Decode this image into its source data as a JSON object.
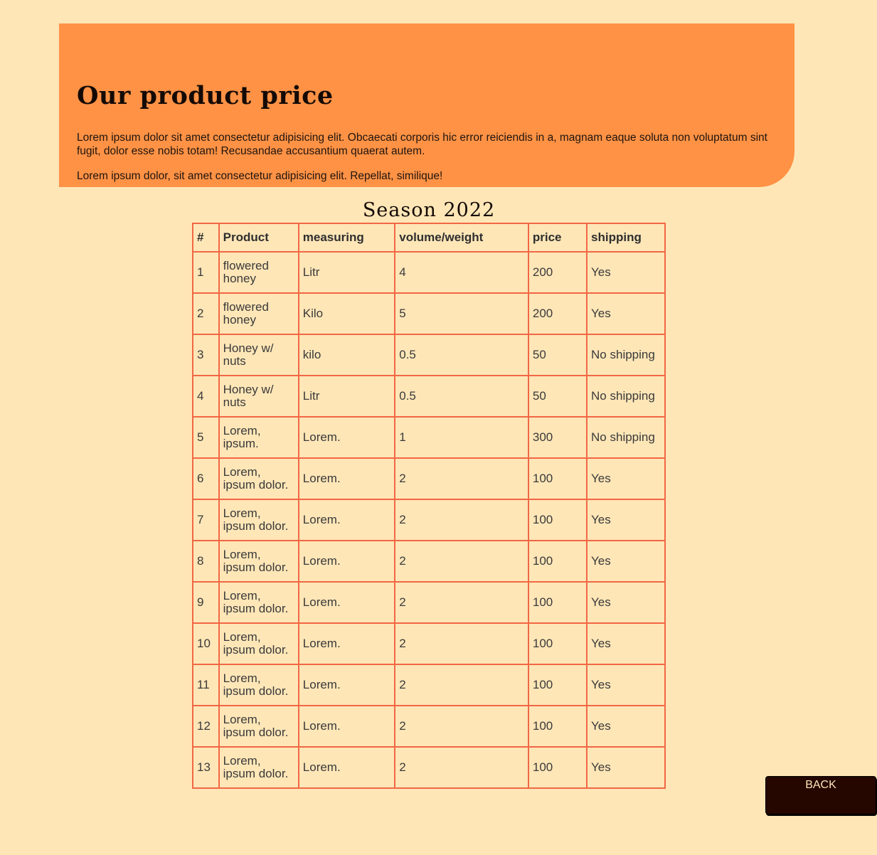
{
  "hero": {
    "title": "Our product price",
    "paragraph1": "Lorem ipsum dolor sit amet consectetur adipisicing elit. Obcaecati corporis hic error reiciendis in a, magnam eaque soluta non voluptatum sint fugit, dolor esse nobis totam! Recusandae accusantium quaerat autem.",
    "paragraph2": "Lorem ipsum dolor, sit amet consectetur adipisicing elit. Repellat, similique!"
  },
  "table": {
    "caption": "Season 2022",
    "headers": [
      "#",
      "Product",
      "measuring",
      "volume/weight",
      "price",
      "shipping"
    ],
    "rows": [
      [
        "1",
        "flowered honey",
        "Litr",
        "4",
        "200",
        "Yes"
      ],
      [
        "2",
        "flowered honey",
        "Kilo",
        "5",
        "200",
        "Yes"
      ],
      [
        "3",
        "Honey w/ nuts",
        "kilo",
        "0.5",
        "50",
        "No shipping"
      ],
      [
        "4",
        "Honey w/ nuts",
        "Litr",
        "0.5",
        "50",
        "No shipping"
      ],
      [
        "5",
        "Lorem, ipsum.",
        "Lorem.",
        "1",
        "300",
        "No shipping"
      ],
      [
        "6",
        "Lorem, ipsum dolor.",
        "Lorem.",
        "2",
        "100",
        "Yes"
      ],
      [
        "7",
        "Lorem, ipsum dolor.",
        "Lorem.",
        "2",
        "100",
        "Yes"
      ],
      [
        "8",
        "Lorem, ipsum dolor.",
        "Lorem.",
        "2",
        "100",
        "Yes"
      ],
      [
        "9",
        "Lorem, ipsum dolor.",
        "Lorem.",
        "2",
        "100",
        "Yes"
      ],
      [
        "10",
        "Lorem, ipsum dolor.",
        "Lorem.",
        "2",
        "100",
        "Yes"
      ],
      [
        "11",
        "Lorem, ipsum dolor.",
        "Lorem.",
        "2",
        "100",
        "Yes"
      ],
      [
        "12",
        "Lorem, ipsum dolor.",
        "Lorem.",
        "2",
        "100",
        "Yes"
      ],
      [
        "13",
        "Lorem, ipsum dolor.",
        "Lorem.",
        "2",
        "100",
        "Yes"
      ]
    ]
  },
  "buttons": {
    "back_label": "BACK"
  },
  "colors": {
    "background": "#fee6b7",
    "hero": "#ff9245",
    "table_border": "#f26744",
    "button": "#250700"
  }
}
